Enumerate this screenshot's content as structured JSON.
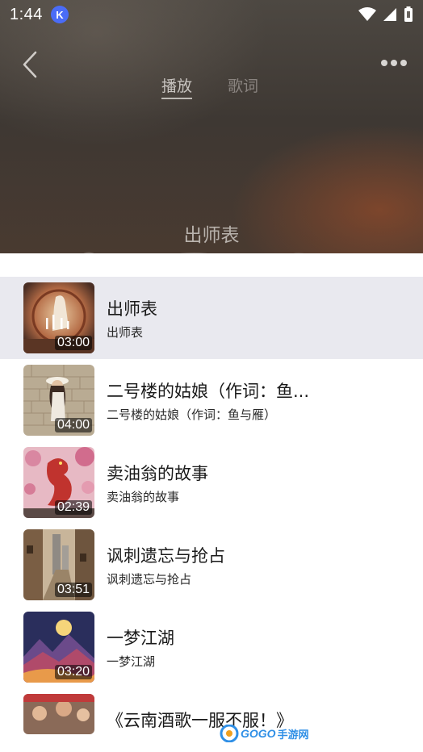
{
  "status_bar": {
    "time": "1:44",
    "badge": "K"
  },
  "header": {
    "tabs": [
      {
        "label": "播放",
        "active": true
      },
      {
        "label": "歌词",
        "active": false
      }
    ]
  },
  "now_playing": {
    "title": "出师表"
  },
  "songs": [
    {
      "title": "出师表",
      "artist": "出师表",
      "duration": "03:00",
      "current": true
    },
    {
      "title": "二号楼的姑娘（作词：鱼...",
      "artist": "二号楼的姑娘（作词：鱼与雁）",
      "duration": "04:00"
    },
    {
      "title": "卖油翁的故事",
      "artist": "卖油翁的故事",
      "duration": "02:39"
    },
    {
      "title": "讽刺遗忘与抢占",
      "artist": "讽刺遗忘与抢占",
      "duration": "03:51"
    },
    {
      "title": "一梦江湖",
      "artist": "一梦江湖",
      "duration": "03:20"
    },
    {
      "title": "《云南酒歌一服不服！》",
      "artist": "",
      "duration": ""
    }
  ],
  "watermark": {
    "brand": "GOGO",
    "suffix": "手游网"
  },
  "colors": {
    "current_row_bg": "#e9e9ef",
    "k_badge": "#4a6cf7",
    "watermark": "#2f8fe6"
  }
}
